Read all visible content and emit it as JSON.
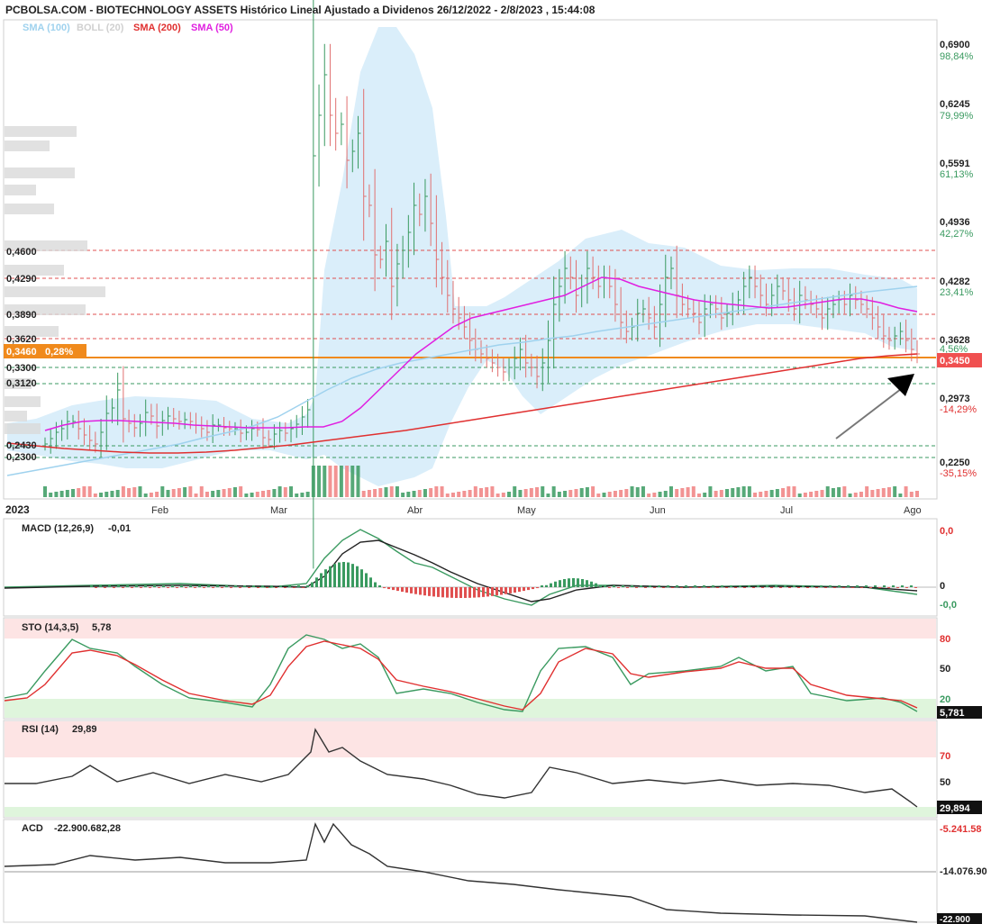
{
  "header": {
    "title": "PCBOLSA.COM - BIOTECHNOLOGY ASSETS Histórico Lineal Ajustado a Dividenos 26/12/2022 - 2/8/2023 , 15:44:08",
    "legend": [
      {
        "label": "SMA (100)",
        "color": "#9fd2ee"
      },
      {
        "label": "BOLL (20)",
        "color": "#d0d0d0"
      },
      {
        "label": "SMA (200)",
        "color": "#e03030"
      },
      {
        "label": "SMA (50)",
        "color": "#e020e0"
      }
    ]
  },
  "colors": {
    "up": "#3a9a60",
    "down": "#e07070",
    "sma50": "#e020e0",
    "sma100": "#9fd2ee",
    "sma200": "#e03030",
    "boll_fill": "#d6ecfa",
    "price_tag": "#f05050",
    "left_tag": "#f08a1c"
  },
  "chart_data": [
    {
      "type": "line",
      "title": "Main price chart",
      "x_labels": [
        "2023",
        "Feb",
        "Mar",
        "Abr",
        "May",
        "Jun",
        "Jul",
        "Ago"
      ],
      "y_ticks": [
        {
          "value": "0,6900",
          "pct": "98,84%"
        },
        {
          "value": "0,6245",
          "pct": "79,99%"
        },
        {
          "value": "0,5591",
          "pct": "61,13%"
        },
        {
          "value": "0,4936",
          "pct": "42,27%"
        },
        {
          "value": "0,4282",
          "pct": "23,41%"
        },
        {
          "value": "0,3628",
          "pct": "4,56%"
        },
        {
          "value": "0,2973",
          "pct": "-14,29%"
        },
        {
          "value": "0,2250",
          "pct": "-35,15%"
        }
      ],
      "ylim": [
        0.225,
        0.69
      ],
      "last_price": "0,3450",
      "left_tag": {
        "value": "0,3460",
        "change": "0,28%"
      },
      "levels_red": [
        "0,4600",
        "0,4290",
        "0,3890",
        "0,3620"
      ],
      "levels_green": [
        "0,3300",
        "0,3120",
        "0,2430",
        "0,2300"
      ],
      "level_values_red": [
        0.46,
        0.429,
        0.389,
        0.362
      ],
      "level_values_green": [
        0.33,
        0.312,
        0.243,
        0.23
      ],
      "series_closes": [
        0.245,
        0.251,
        0.258,
        0.262,
        0.27,
        0.27,
        0.262,
        0.255,
        0.249,
        0.245,
        0.258,
        0.279,
        0.285,
        0.305,
        0.273,
        0.268,
        0.263,
        0.268,
        0.28,
        0.276,
        0.265,
        0.271,
        0.276,
        0.273,
        0.27,
        0.272,
        0.27,
        0.266,
        0.262,
        0.258,
        0.266,
        0.266,
        0.263,
        0.262,
        0.262,
        0.257,
        0.258,
        0.262,
        0.261,
        0.252,
        0.25,
        0.256,
        0.26,
        0.257,
        0.262,
        0.267,
        0.275,
        0.283,
        0.565,
        0.61,
        0.655,
        0.61,
        0.59,
        0.6,
        0.56,
        0.57,
        0.59,
        0.52,
        0.51,
        0.455,
        0.45,
        0.47,
        0.42,
        0.445,
        0.46,
        0.48,
        0.51,
        0.5,
        0.52,
        0.49,
        0.45,
        0.43,
        0.41,
        0.395,
        0.385,
        0.375,
        0.36,
        0.35,
        0.345,
        0.34,
        0.335,
        0.33,
        0.325,
        0.33,
        0.34,
        0.35,
        0.335,
        0.33,
        0.32,
        0.335,
        0.36,
        0.4,
        0.42,
        0.44,
        0.43,
        0.41,
        0.42,
        0.44,
        0.43,
        0.42,
        0.43,
        0.42,
        0.4,
        0.38,
        0.37,
        0.375,
        0.39,
        0.395,
        0.385,
        0.375,
        0.4,
        0.43,
        0.44,
        0.41,
        0.4,
        0.395,
        0.39,
        0.38,
        0.395,
        0.4,
        0.395,
        0.385,
        0.39,
        0.4,
        0.405,
        0.42,
        0.43,
        0.42,
        0.41,
        0.4,
        0.41,
        0.42,
        0.415,
        0.405,
        0.395,
        0.41,
        0.405,
        0.4,
        0.395,
        0.385,
        0.395,
        0.4,
        0.405,
        0.4,
        0.41,
        0.405,
        0.4,
        0.395,
        0.385,
        0.375,
        0.365,
        0.36,
        0.365,
        0.37,
        0.36,
        0.35,
        0.345
      ],
      "sma50": [
        0.26,
        0.266,
        0.27,
        0.271,
        0.271,
        0.27,
        0.269,
        0.268,
        0.266,
        0.265,
        0.264,
        0.263,
        0.263,
        0.263,
        0.264,
        0.264,
        0.27,
        0.285,
        0.305,
        0.325,
        0.345,
        0.36,
        0.375,
        0.385,
        0.39,
        0.395,
        0.4,
        0.405,
        0.41,
        0.42,
        0.43,
        0.428,
        0.42,
        0.415,
        0.41,
        0.405,
        0.402,
        0.4,
        0.398,
        0.396,
        0.397,
        0.4,
        0.403,
        0.406,
        0.406,
        0.402,
        0.396,
        0.392
      ],
      "sma100": [
        0.21,
        0.215,
        0.22,
        0.225,
        0.23,
        0.235,
        0.24,
        0.245,
        0.252,
        0.258,
        0.265,
        0.275,
        0.29,
        0.305,
        0.318,
        0.328,
        0.335,
        0.34,
        0.345,
        0.35,
        0.355,
        0.358,
        0.362,
        0.365,
        0.37,
        0.374,
        0.378,
        0.382,
        0.386,
        0.39,
        0.394,
        0.398,
        0.402,
        0.406,
        0.41,
        0.414,
        0.417,
        0.42
      ],
      "sma200": [
        0.246,
        0.243,
        0.24,
        0.238,
        0.236,
        0.235,
        0.235,
        0.236,
        0.238,
        0.241,
        0.244,
        0.248,
        0.252,
        0.256,
        0.26,
        0.265,
        0.27,
        0.275,
        0.28,
        0.285,
        0.29,
        0.295,
        0.3,
        0.305,
        0.31,
        0.315,
        0.32,
        0.325,
        0.33,
        0.335,
        0.34,
        0.343,
        0.345
      ]
    },
    {
      "type": "line",
      "title": "MACD (12,26,9)",
      "value": "-0,01",
      "right_labels": [
        "0,0",
        "0",
        "-0,0"
      ]
    },
    {
      "type": "line",
      "title": "STO (14,3,5)",
      "value": "5,78",
      "right_labels": [
        "80",
        "50",
        "20"
      ],
      "last": "5,781"
    },
    {
      "type": "line",
      "title": "RSI (14)",
      "value": "29,89",
      "right_labels": [
        "70",
        "50"
      ],
      "last": "29,894"
    },
    {
      "type": "line",
      "title": "ACD",
      "value": "-22.900.682,28",
      "right_labels": [
        "-5.241.58",
        "-14.076.90",
        "-22.900"
      ]
    }
  ]
}
